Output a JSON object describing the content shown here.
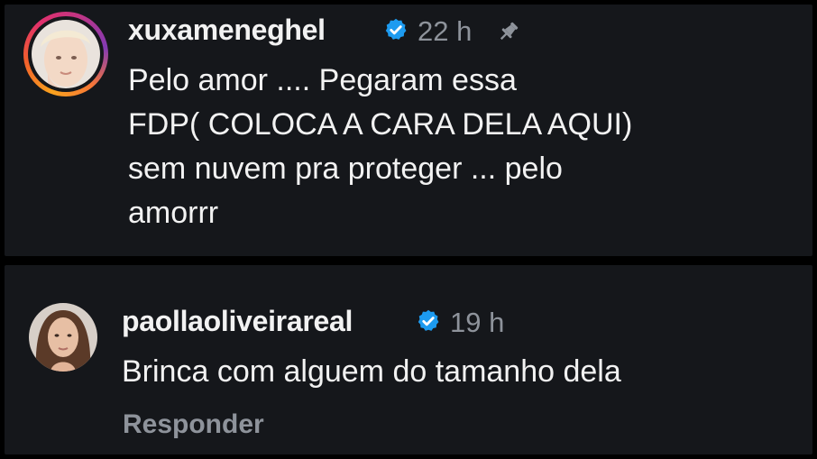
{
  "comments": [
    {
      "username": "xuxameneghel",
      "verified": true,
      "has_story_ring": true,
      "timestamp": "22 h",
      "pinned": true,
      "text": "Pelo amor .... Pegaram essa\nFDP( COLOCA A CARA DELA AQUI)\nsem nuvem pra proteger ... pelo\namorrr"
    },
    {
      "username": "paollaoliveirareal",
      "verified": true,
      "has_story_ring": false,
      "timestamp": "19 h",
      "pinned": false,
      "text": "Brinca com alguem do tamanho dela",
      "reply_label": "Responder"
    }
  ],
  "colors": {
    "background": "#15171b",
    "text": "#f2f2f2",
    "muted": "#8e939b",
    "verified": "#1d9bf0"
  }
}
